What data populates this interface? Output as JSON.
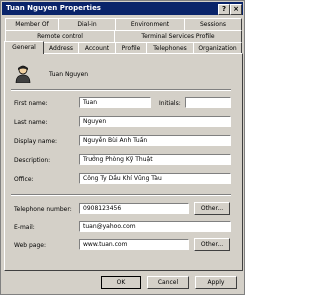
{
  "window": {
    "title": "Tuan Nguyen Properties",
    "help_glyph": "?",
    "close_glyph": "×"
  },
  "tabs": {
    "row1": [
      "Member Of",
      "Dial-in",
      "Environment",
      "Sessions"
    ],
    "row2": [
      "Remote control",
      "Terminal Services Profile"
    ],
    "row3": [
      "General",
      "Address",
      "Account",
      "Profile",
      "Telephones",
      "Organization"
    ],
    "active": "General"
  },
  "general": {
    "display_name_header": "Tuan Nguyen",
    "user_icon": "user-icon",
    "first_name_label": "First name:",
    "first_name_value": "Tuan",
    "initials_label": "Initials:",
    "initials_value": "",
    "last_name_label": "Last name:",
    "last_name_value": "Nguyen",
    "display_name_label": "Display name:",
    "display_name_value": "Nguyễn Bùi Anh Tuấn",
    "description_label": "Description:",
    "description_value": "Trưởng Phòng Kỹ Thuật",
    "office_label": "Office:",
    "office_value": "Công Ty Dầu Khí Vũng Tàu",
    "telephone_label": "Telephone number:",
    "telephone_value": "0908123456",
    "email_label": "E-mail:",
    "email_value": "tuan@yahoo.com",
    "webpage_label": "Web page:",
    "webpage_value": "www.tuan.com",
    "other_label": "Other..."
  },
  "buttons": {
    "ok": "OK",
    "cancel": "Cancel",
    "apply": "Apply"
  }
}
